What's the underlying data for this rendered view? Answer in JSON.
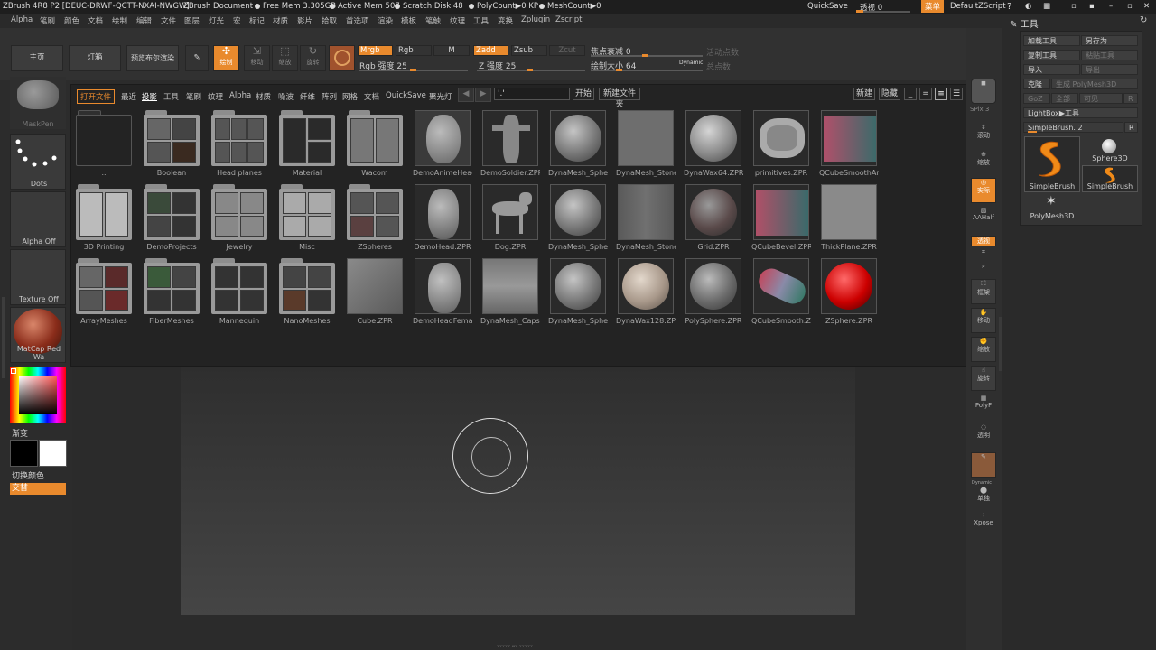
{
  "titlebar": {
    "app": "ZBrush 4R8 P2 [DEUC-DRWF-QCTT-NXAI-NWGW]",
    "doc": "ZBrush Document",
    "free_mem": "Free Mem 3.305GB",
    "active_mem": "Active Mem 507",
    "scratch": "Scratch Disk 48",
    "polycount": "PolyCount▶0 KP",
    "meshcount": "MeshCount▶0",
    "quicksave": "QuickSave",
    "transparency": "透视 0",
    "menu_btn": "菜单",
    "script": "DefaultZScript"
  },
  "menubar": [
    "Alpha",
    "笔刷",
    "颜色",
    "文档",
    "绘制",
    "编辑",
    "文件",
    "图层",
    "灯光",
    "宏",
    "标记",
    "材质",
    "影片",
    "拾取",
    "首选项",
    "渲染",
    "模板",
    "笔触",
    "纹理",
    "工具",
    "变换",
    "Zplugin",
    "Zscript"
  ],
  "shelf": {
    "home": "主页",
    "lightbox": "灯箱",
    "preview_render": "预览布尔渲染",
    "edit": "编辑",
    "draw": "绘制",
    "move": "移动",
    "scale": "缩放",
    "rotate": "旋转",
    "mrgb": "Mrgb",
    "rgb": "Rgb",
    "m": "M",
    "zadd": "Zadd",
    "zsub": "Zsub",
    "zcut": "Zcut",
    "rgb_intensity": "Rgb 强度 25",
    "z_intensity": "Z 强度 25",
    "focal_shift": "焦点衰减 0",
    "draw_size": "绘制大小 64",
    "dynamic": "Dynamic",
    "active_points": "活动点数",
    "total_points": "总点数"
  },
  "left": {
    "maskpen": "MaskPen",
    "dots": "Dots",
    "alpha": "Alpha Off",
    "texture": "Texture Off",
    "matcap": "MatCap Red Wa",
    "gradient": "渐变",
    "switch_color": "切换颜色",
    "alternate": "交替"
  },
  "lightbox": {
    "tabs": [
      "打开文件",
      "最近",
      "投影",
      "工具",
      "笔刷",
      "纹理",
      "Alpha",
      "材质",
      "噪波",
      "纤维",
      "阵列",
      "网格",
      "文档",
      "QuickSave",
      "聚光灯"
    ],
    "path_value": "'.'",
    "start": "开始",
    "new_folder": "新建文件夹",
    "new": "新建",
    "hide": "隐藏",
    "rows": [
      [
        "..",
        "Boolean",
        "Head planes",
        "Material",
        "Wacom",
        "DemoAnimeHead.ZPR",
        "DemoSoldier.ZPR",
        "DynaMesh_Sphere",
        "DynaMesh_Stone",
        "DynaWax64.ZPR",
        "primitives.ZPR",
        "QCubeSmoothAn"
      ],
      [
        "3D Printing",
        "DemoProjects",
        "Jewelry",
        "Misc",
        "ZSpheres",
        "DemoHead.ZPR",
        "Dog.ZPR",
        "DynaMesh_Sphere",
        "DynaMesh_Stone",
        "Grid.ZPR",
        "QCubeBevel.ZPR",
        "ThickPlane.ZPR"
      ],
      [
        "ArrayMeshes",
        "FiberMeshes",
        "Mannequin",
        "NanoMeshes",
        "Cube.ZPR",
        "DemoHeadFemale",
        "DynaMesh_Capsule",
        "DynaMesh_Sphere",
        "DynaWax128.ZPR",
        "PolySphere.ZPR",
        "QCubeSmooth.ZPR",
        "ZSphere.ZPR"
      ]
    ]
  },
  "righttool": {
    "bpr": "BPR",
    "spix": "SPix 3",
    "scroll": "滚动",
    "zoom": "缩放",
    "actual": "实际",
    "aahalf": "AAHalf",
    "persp": "透视",
    "floor": "地面",
    "local": "局部",
    "lsym": "L.Sym",
    "frame": "框架",
    "move": "移动",
    "scale": "缩放",
    "rotate": "旋转",
    "polyf": "PolyF",
    "transp": "透明",
    "dynamic": "Dynamic",
    "solo": "单独",
    "xpose": "Xpose"
  },
  "toolpanel": {
    "header": "工具",
    "load": "加载工具",
    "save_as": "另存为",
    "copy": "复制工具",
    "paste": "粘贴工具",
    "import": "导入",
    "export": "导出",
    "clone": "克隆",
    "make_polymesh": "生成 PolyMesh3D",
    "goz": "GoZ",
    "all": "全部",
    "visible": "可见",
    "r": "R",
    "lightbox_tool": "LightBox▶工具",
    "current": "SimpleBrush. 2",
    "tools": [
      "SimpleBrush",
      "Sphere3D",
      "SimpleBrush",
      "PolyMesh3D"
    ]
  }
}
